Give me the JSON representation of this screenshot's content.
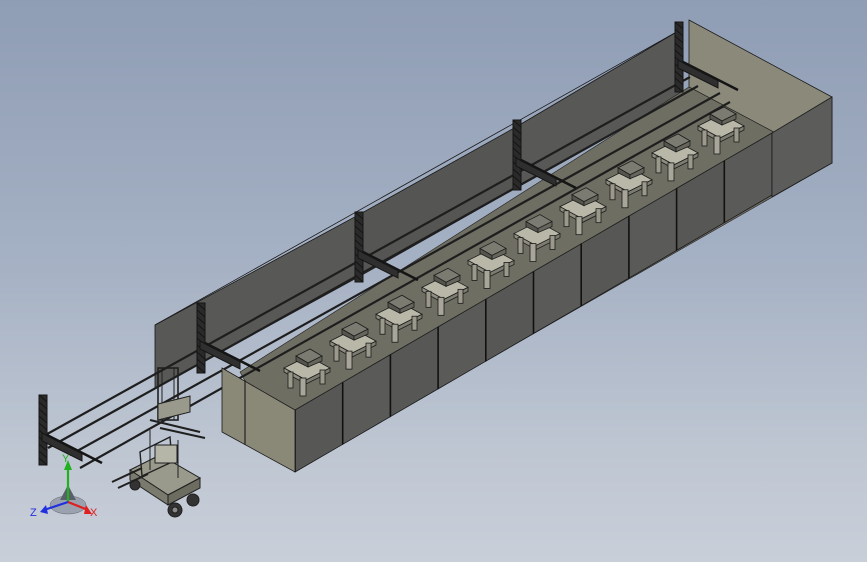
{
  "viewport": {
    "background_top": "#8f9db5",
    "background_bottom": "#c9cfd9"
  },
  "triad": {
    "x_label": "X",
    "y_label": "Y",
    "z_label": "Z",
    "x_color": "#e02020",
    "y_color": "#20b020",
    "z_color": "#2030e0"
  },
  "model": {
    "workstation_count": 10,
    "gantry_count": 4,
    "wall_color": "#5a5a58",
    "floor_color": "#8c8b7c"
  }
}
